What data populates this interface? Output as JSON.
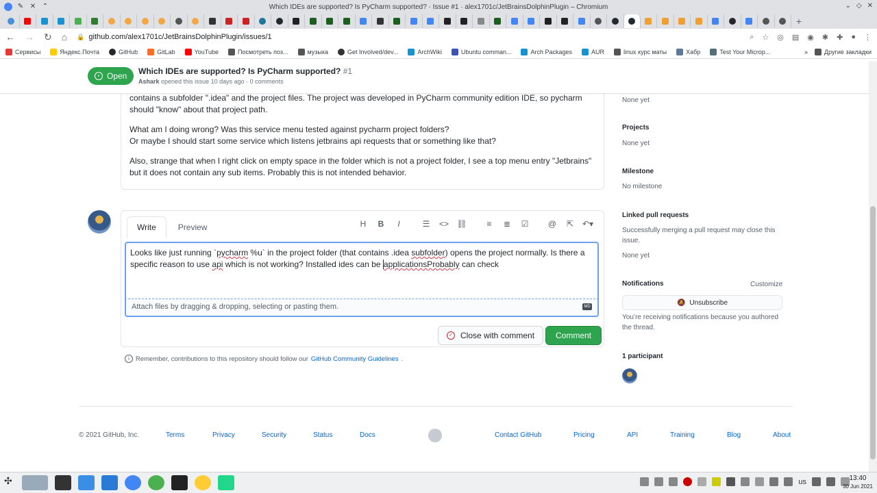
{
  "browser": {
    "window_title": "Which IDEs are supported? Is PyCharm supported? · Issue #1 · alex1701c/JetBrainsDolphinPlugin – Chromium",
    "url": "github.com/alex1701c/JetBrainsDolphinPlugin/issues/1",
    "bookmarks": [
      "Сервисы",
      "Яндекс.Почта",
      "GitHub",
      "GitLab",
      "YouTube",
      "Посмотреть поз...",
      "музыка",
      "Get Involved/dev...",
      "ArchWiki",
      "Ubuntu comman...",
      "Arch Packages",
      "AUR",
      "linux курс маты",
      "Хабр",
      "Test Your Microp..."
    ],
    "other_bookmarks": "Другие закладки"
  },
  "issue": {
    "state": "Open",
    "title": "Which IDEs are supported? Is PyCharm supported?",
    "number": "#1",
    "author": "Ashark",
    "meta": "opened this issue 10 days ago · 0 comments"
  },
  "comment": {
    "p1": "contains a subfolder \".idea\" and the project files. The project was developed in PyCharm community edition IDE, so pycharm should \"know\" about that project path.",
    "p2a": "What am I doing wrong? Was this service menu tested against pycharm project folders?",
    "p2b": "Or maybe I should start some service which listens jetbrains api requests that or something like that?",
    "p3": "Also, strange that when I right click on empty space in the folder which is not a project folder, I see a top menu entry \"Jetbrains\" but it does not contain any sub items. Probably this is not intended behavior."
  },
  "form": {
    "tab_write": "Write",
    "tab_preview": "Preview",
    "text_a": "Looks like just running `",
    "text_w1": "pycharm",
    "text_b": " %u` in the project folder (that contains .idea ",
    "text_w2": "subfolder",
    "text_c": ") opens the project normally. Is there a specific reason to use ",
    "text_w3": "api",
    "text_d": " which is not working? Installed ides can be ",
    "text_w4": "applicationsProbably",
    "text_e": " can check",
    "attach": "Attach files by dragging & dropping, selecting or pasting them.",
    "md_badge": "MD",
    "close_label": "Close with comment",
    "comment_label": "Comment",
    "remember": "Remember, contributions to this repository should follow our",
    "guidelines": "GitHub Community Guidelines",
    "remember_end": "."
  },
  "sidebar": {
    "labels_value": "None yet",
    "projects": "Projects",
    "projects_value": "None yet",
    "milestone": "Milestone",
    "milestone_value": "No milestone",
    "linked": "Linked pull requests",
    "linked_text": "Successfully merging a pull request may close this issue.",
    "linked_value": "None yet",
    "notifications": "Notifications",
    "customize": "Customize",
    "unsubscribe": "Unsubscribe",
    "notif_text": "You’re receiving notifications because you authored the thread.",
    "participants": "1 participant"
  },
  "footer": {
    "copyright": "© 2021 GitHub, Inc.",
    "links": [
      "Terms",
      "Privacy",
      "Security",
      "Status",
      "Docs",
      "Contact GitHub",
      "Pricing",
      "API",
      "Training",
      "Blog",
      "About"
    ]
  },
  "taskbar": {
    "layout": "us",
    "time": "13:40",
    "date": "30 Jun 2021"
  },
  "colors": {
    "open_green": "#2ea44f",
    "link_blue": "#0366d6",
    "close_red": "#cb2431"
  }
}
